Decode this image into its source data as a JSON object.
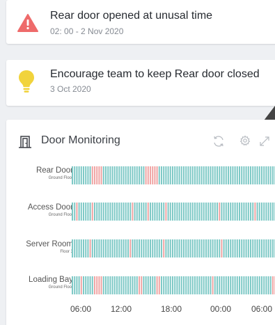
{
  "alerts": [
    {
      "title": "Rear door opened at unusal time",
      "subtitle": "02: 00 - 2 Nov 2020",
      "icon": "warning-triangle-icon",
      "color": "#ee6b6b"
    },
    {
      "title": "Encourage team to keep Rear door closed",
      "subtitle": "3 Oct 2020",
      "icon": "lightbulb-icon",
      "color": "#f1d33c"
    }
  ],
  "widget": {
    "title": "Door Monitoring",
    "icons": [
      "building-door-icon",
      "refresh-icon",
      "settings-icon",
      "expand-icon"
    ],
    "colors": {
      "closed": "#7ec9c6",
      "open": "#f0a5a4"
    },
    "doors": [
      {
        "name": "Rear Door",
        "floor": "Ground Floor",
        "open_ranges": [
          [
            8.3,
            9.8
          ],
          [
            15.0,
            16.6
          ]
        ]
      },
      {
        "name": "Access Door",
        "floor": "Ground Floor",
        "open_ranges": [
          [
            6.4,
            6.8
          ],
          [
            8.3,
            8.6
          ],
          [
            13.2,
            13.5
          ],
          [
            15.2,
            15.5
          ],
          [
            17.4,
            17.7
          ],
          [
            23.8,
            24.1
          ],
          [
            28.2,
            28.5
          ]
        ]
      },
      {
        "name": "Server Room",
        "floor": "Floor 3",
        "open_ranges": [
          [
            8.0,
            8.3
          ],
          [
            13.0,
            13.3
          ],
          [
            17.0,
            17.3
          ],
          [
            24.3,
            24.6
          ]
        ]
      },
      {
        "name": "Loading Bay",
        "floor": "Ground Floor",
        "open_ranges": [
          [
            7.0,
            7.3
          ],
          [
            8.6,
            9.6
          ],
          [
            14.2,
            14.5
          ],
          [
            16.3,
            16.8
          ],
          [
            23.0,
            23.3
          ],
          [
            30.5,
            31.2
          ]
        ]
      }
    ],
    "x_ticks": [
      "06:00",
      "12:00",
      "18:00",
      "00:00",
      "06:00"
    ],
    "x_range_hours": [
      6,
      31.5
    ]
  }
}
